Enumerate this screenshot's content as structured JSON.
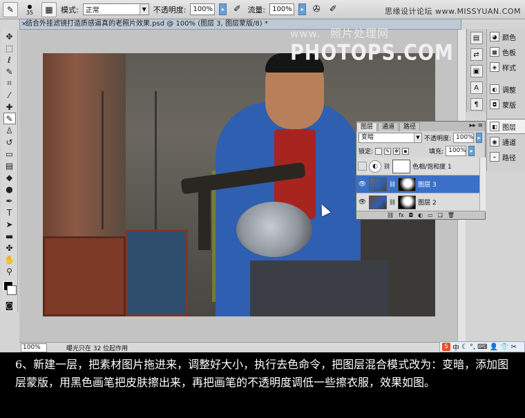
{
  "options_bar": {
    "brush_size": "35",
    "mode_label": "模式:",
    "mode_value": "正常",
    "opacity_label": "不透明度:",
    "opacity_value": "100%",
    "flow_label": "流量:",
    "flow_value": "100%",
    "site_mark": "思缘设计论坛 www.MISSYUAN.COM"
  },
  "document": {
    "title": "结合外挂滤镜打造质感逼真的老照片效果.psd @ 100% (图层 3, 图层蒙版/8) *"
  },
  "watermark": {
    "line1": "www.",
    "line1_cn": "照片处理网",
    "line2": "PHOTOPS.COM"
  },
  "status_bar": {
    "zoom": "100%",
    "info": "曝光只在 32 位起作用"
  },
  "layers_panel": {
    "tabs": [
      "图层",
      "通道",
      "路径"
    ],
    "blend_mode": "变暗",
    "opacity_label": "不透明度:",
    "opacity_value": "100%",
    "lock_label": "锁定:",
    "fill_label": "填充:",
    "fill_value": "100%",
    "layers": [
      {
        "name": "色相/饱和度 1",
        "visible": false,
        "selected": false,
        "type": "adjustment"
      },
      {
        "name": "图层 3",
        "visible": true,
        "selected": true,
        "type": "pixel-with-mask"
      },
      {
        "name": "图层 2",
        "visible": true,
        "selected": false,
        "type": "pixel-with-mask"
      }
    ]
  },
  "dock": {
    "items": [
      "颜色",
      "色板",
      "样式",
      "调整",
      "蒙版",
      "图层",
      "通道",
      "路径"
    ],
    "active": "图层"
  },
  "tray": {
    "text": "中"
  },
  "caption": {
    "text": "6、新建一层，把素材图片拖进来，调整好大小，执行去色命令，把图层混合模式改为：变暗，添加图层蒙版，用黑色画笔把皮肤擦出来，再把画笔的不透明度调低一些擦衣服，效果如图。"
  }
}
